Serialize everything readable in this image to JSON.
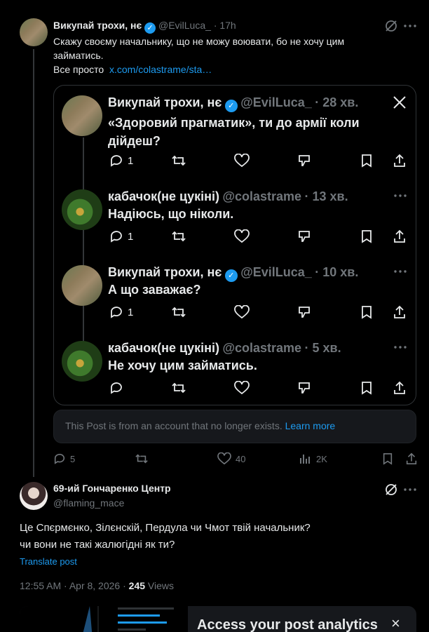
{
  "quoted_post": {
    "author_name": "Викупай трохи, нє",
    "handle": "@EvilLuca_",
    "time": "· 17h",
    "text_line1": "Скажу своєму начальнику, що не можу воювати, бо не хочу цим",
    "text_line2": "займатись.",
    "text_line3_prefix": "Все просто",
    "link": "x.com/colastrame/sta…",
    "stats": {
      "replies": "5",
      "likes": "40",
      "views": "2K"
    }
  },
  "embed": {
    "items": [
      {
        "name": "Викупай трохи, нє",
        "handle": "@EvilLuca_",
        "time": "· 28 хв.",
        "text1": "«Здоровий прагматик», ти до армії коли",
        "text2": "дійдеш?",
        "replies": "1"
      },
      {
        "name": "кабачок(не цукіні)",
        "handle": "@colastrame",
        "time": "· 13 хв.",
        "text1": "Надіюсь, що ніколи.",
        "replies": "1"
      },
      {
        "name": "Викупай трохи, нє",
        "handle": "@EvilLuca_",
        "time": "· 10 хв.",
        "text1": "А що заважає?",
        "replies": "1"
      },
      {
        "name": "кабачок(не цукіні)",
        "handle": "@colastrame",
        "time": "· 5 хв.",
        "text1": "Не хочу цим займатись."
      }
    ]
  },
  "notice": {
    "text": "This Post is from an account that no longer exists.",
    "link": "Learn more"
  },
  "main_post": {
    "author_name": "69-ий Гончаренко Центр",
    "handle": "@flaming_mace",
    "text_line1": "Це Спєрмєнко, Зілєнскій, Пердула чи Чмот твій начальник?",
    "text_line2": "чи вони не такі жалюгідні як ти?",
    "translate": "Translate post",
    "time": "12:55 AM · Apr 8, 2026 · ",
    "views_count": "245",
    "views_label": " Views"
  },
  "analytics": {
    "title": "Access your post analytics",
    "close": "×"
  },
  "colors": {
    "accent": "#1d9bf0",
    "bg": "#000000",
    "muted": "#71767b",
    "divider": "#2f3336"
  },
  "icons": [
    "grok-icon",
    "more-icon",
    "reply-icon",
    "retweet-icon",
    "like-icon",
    "views-icon",
    "bookmark-icon",
    "share-icon",
    "x-logo-icon",
    "downvote-icon",
    "verified-icon",
    "close-icon"
  ]
}
